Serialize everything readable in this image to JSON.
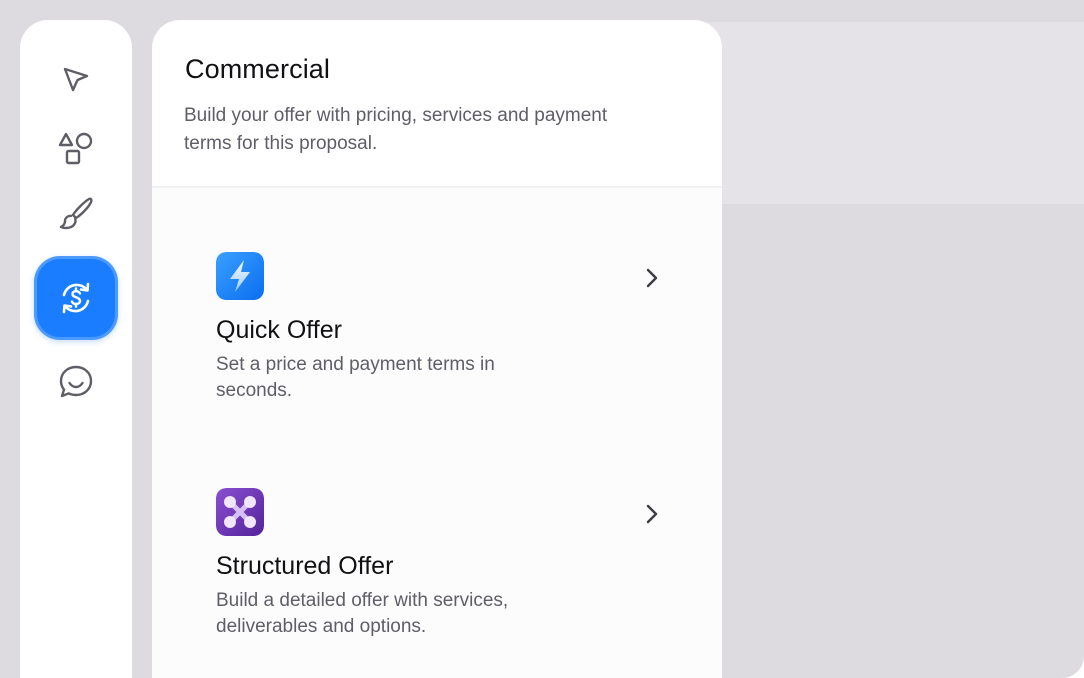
{
  "rail": {
    "items": [
      {
        "name": "select-tool",
        "icon": "cursor-arrow-icon",
        "active": false
      },
      {
        "name": "shapes-tool",
        "icon": "shapes-icon",
        "active": false
      },
      {
        "name": "brush-tool",
        "icon": "paintbrush-icon",
        "active": false
      },
      {
        "name": "commercial-tool",
        "icon": "dollar-cycle-icon",
        "active": true
      },
      {
        "name": "comments-tool",
        "icon": "chat-bubble-icon",
        "active": false
      }
    ],
    "accent": "#1a7dff"
  },
  "panel": {
    "title": "Commercial",
    "description": "Build your offer with pricing, services and payment terms for this proposal."
  },
  "offers": [
    {
      "title": "Quick Offer",
      "description": "Set a price and payment terms in seconds.",
      "icon": "lightning-icon",
      "icon_color": "#1e88ff"
    },
    {
      "title": "Structured Offer",
      "description": "Build a detailed offer with services, deliverables and options.",
      "icon": "nodes-icon",
      "icon_color": "#6a35b0"
    }
  ]
}
